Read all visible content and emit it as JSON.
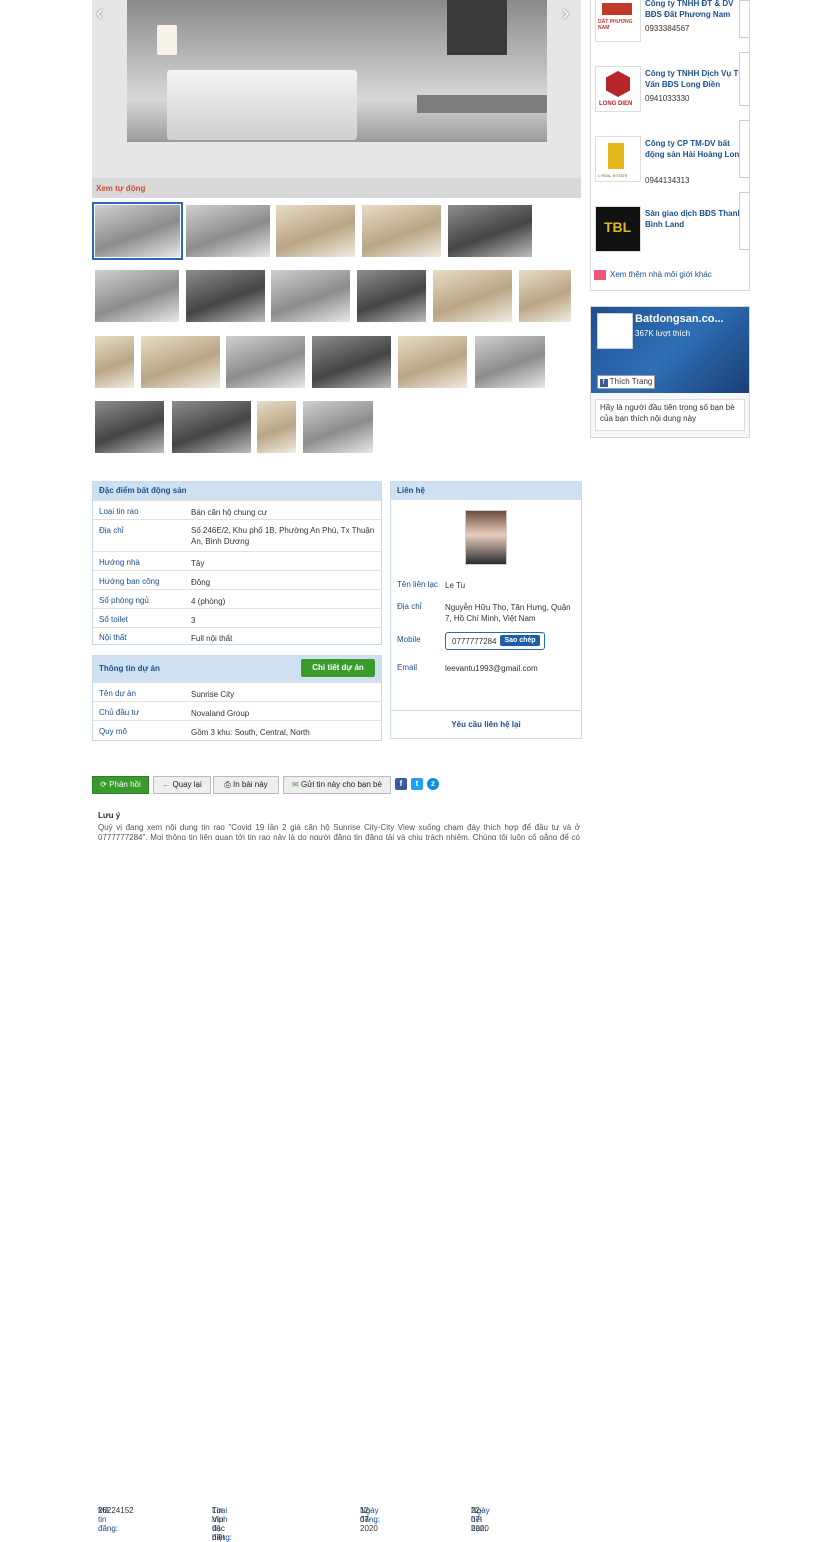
{
  "gallery": {
    "autoplay_label": "Xem tự động",
    "prev_icon": "chevron-left-icon",
    "next_icon": "chevron-right-icon"
  },
  "agencies": {
    "items": [
      {
        "name": "Công ty TNHH ĐT & DV BĐS Đất Phương Nam",
        "phone": "0933384567",
        "logo_text": "DẤT PHƯƠNG NAM"
      },
      {
        "name": "Công ty TNHH Dịch Vụ Tư Vấn BĐS Long Điền",
        "phone": "0941033330",
        "logo_text": "LONG DIEN"
      },
      {
        "name": "Công ty CP TM-DV bất động sản Hải Hoàng Long",
        "phone": "0944134313",
        "logo_text": "L REAL ESTATE"
      },
      {
        "name": "Sàn giao dịch BĐS Thanh Bình Land",
        "phone": "",
        "logo_text": "TBL"
      }
    ],
    "more_label": "Xem thêm nhà môi giới khác"
  },
  "facebook": {
    "page_name": "Batdongsan.co...",
    "likes": "367K lượt thích",
    "like_button": "Thích Trang",
    "message": "Hãy là người đầu tiên trong số bạn bè của bạn thích nội dung này"
  },
  "property": {
    "header": "Đặc điểm bất động sản",
    "rows": [
      {
        "key": "Loại tin rao",
        "value": "Bán căn hộ chung cư"
      },
      {
        "key": "Địa chỉ",
        "value": "Số 246E/2, Khu phố 1B, Phường An Phú, Tx Thuận An, Bình Dương"
      },
      {
        "key": "Hướng nhà",
        "value": "Tây"
      },
      {
        "key": "Hướng ban công",
        "value": "Đông"
      },
      {
        "key": "Số phòng ngủ",
        "value": "4 (phòng)"
      },
      {
        "key": "Số toilet",
        "value": "3"
      },
      {
        "key": "Nội thất",
        "value": "Full nội thất"
      }
    ]
  },
  "project": {
    "header": "Thông tin dự án",
    "detail_button": "Chi tiết dự án",
    "rows": [
      {
        "key": "Tên dự án",
        "value": "Sunrise City"
      },
      {
        "key": "Chủ đầu tư",
        "value": "Novaland Group"
      },
      {
        "key": "Quy mô",
        "value": "Gồm 3 khu: South, Central, North"
      }
    ]
  },
  "contact": {
    "header": "Liên hệ",
    "name_label": "Tên liên lạc",
    "name": "Le Tu",
    "address_label": "Địa chỉ",
    "address": "Nguyễn Hữu Thọ, Tân Hưng, Quận 7, Hồ Chí Minh, Việt Nam",
    "mobile_label": "Mobile",
    "mobile": "0777777284",
    "copy_button": "Sao chép",
    "email_label": "Email",
    "email": "leevantu1993@gmail.com",
    "request_link": "Yêu cầu liên hệ lại"
  },
  "meta": {
    "id_label": "Mã tin đăng:",
    "id": "26224152",
    "type_label": "Loại hình tin đăng:",
    "type": "Tin Vip đặc biệt",
    "posted_label": "Ngày đăng:",
    "posted": "12-07-2020",
    "expire_label": "Ngày hết hạn:",
    "expire": "22-07-2020"
  },
  "actions": {
    "refresh": "Phản hồi",
    "back": "Quay lại",
    "print": "In bài này",
    "send": "Gửi tin này cho bạn bè"
  },
  "note": {
    "title": "Lưu ý",
    "text": "Quý vị đang xem nội dung tin rao \"Covid 19 lần 2 giá căn hộ Sunrise City-City View xuống chạm đáy thích hợp để đầu tư và ở 0777777284\". Mọi thông tin liên quan tới tin rao này là do người đăng tin đăng tải và chịu trách nhiệm. Chúng tôi luôn cố gắng để có chất"
  },
  "colors": {
    "link": "#1b4f91",
    "header_bg": "#cfe1f1",
    "green": "#3a9a2e",
    "accent_red": "#d84c2b"
  }
}
